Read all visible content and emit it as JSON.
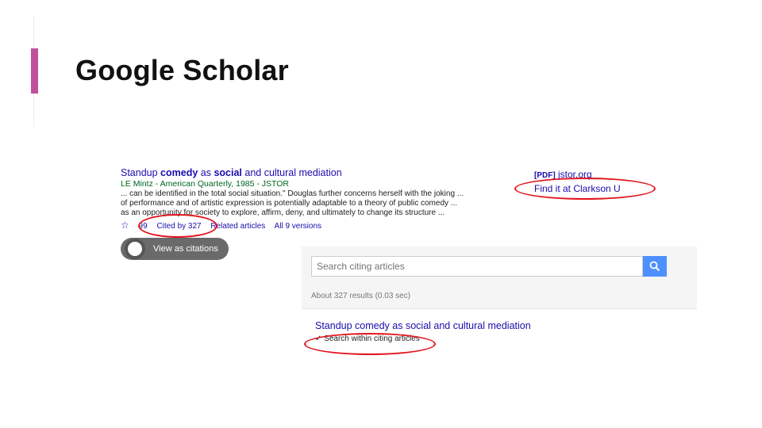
{
  "slide": {
    "title": "Google Scholar"
  },
  "result": {
    "title_part1": "Standup ",
    "title_bold1": "comedy",
    "title_part2": " as ",
    "title_bold2": "social",
    "title_part3": " and cultural mediation",
    "authors": "LE Mintz - American Quarterly, 1985 - JSTOR",
    "snippet_line1": "... can be identified in the total social situation.\" Douglas further concerns herself with the joking ...",
    "snippet_line2": "of performance and of artistic expression is potentially adaptable to a theory of public comedy ...",
    "snippet_line3": "as an opportunity for society to explore, affirm, deny, and ultimately to change its structure ...",
    "star_icon": "star-icon",
    "quote_label": "99",
    "cited_by": "Cited by 327",
    "related": "Related articles",
    "versions": "All 9 versions"
  },
  "side": {
    "pdf_tag": "[PDF]",
    "pdf_source": " jstor.org",
    "find_it": "Find it at Clarkson U"
  },
  "toggle": {
    "label": "View as citations"
  },
  "search": {
    "placeholder": "Search citing articles",
    "button_icon": "search-icon",
    "results_count": "About 327 results (0.03 sec)"
  },
  "within": {
    "title": "Standup comedy as social and cultural mediation",
    "check_mark": "✓",
    "check_label": " Search within citing articles"
  },
  "colors": {
    "accent": "#c0529b",
    "link": "#1a0dab",
    "highlight": "#e2141d",
    "button": "#4d90fe"
  }
}
